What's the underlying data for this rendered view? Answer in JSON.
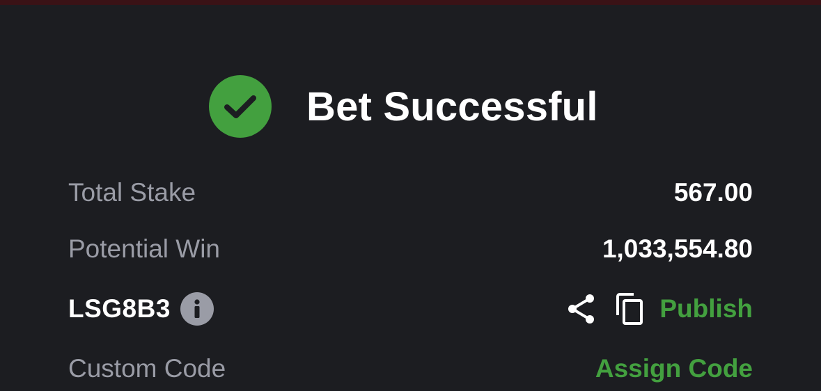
{
  "header": {
    "title": "Bet Successful",
    "status_icon": "check-circle-icon",
    "accent_color": "#43a03f"
  },
  "summary": {
    "total_stake": {
      "label": "Total Stake",
      "value": "567.00"
    },
    "potential_win": {
      "label": "Potential Win",
      "value": "1,033,554.80"
    }
  },
  "booking": {
    "code": "LSG8B3",
    "info_icon": "info-icon",
    "share_icon": "share-icon",
    "copy_icon": "copy-icon",
    "publish_label": "Publish"
  },
  "custom_code": {
    "label": "Custom Code",
    "action_label": "Assign Code"
  }
}
